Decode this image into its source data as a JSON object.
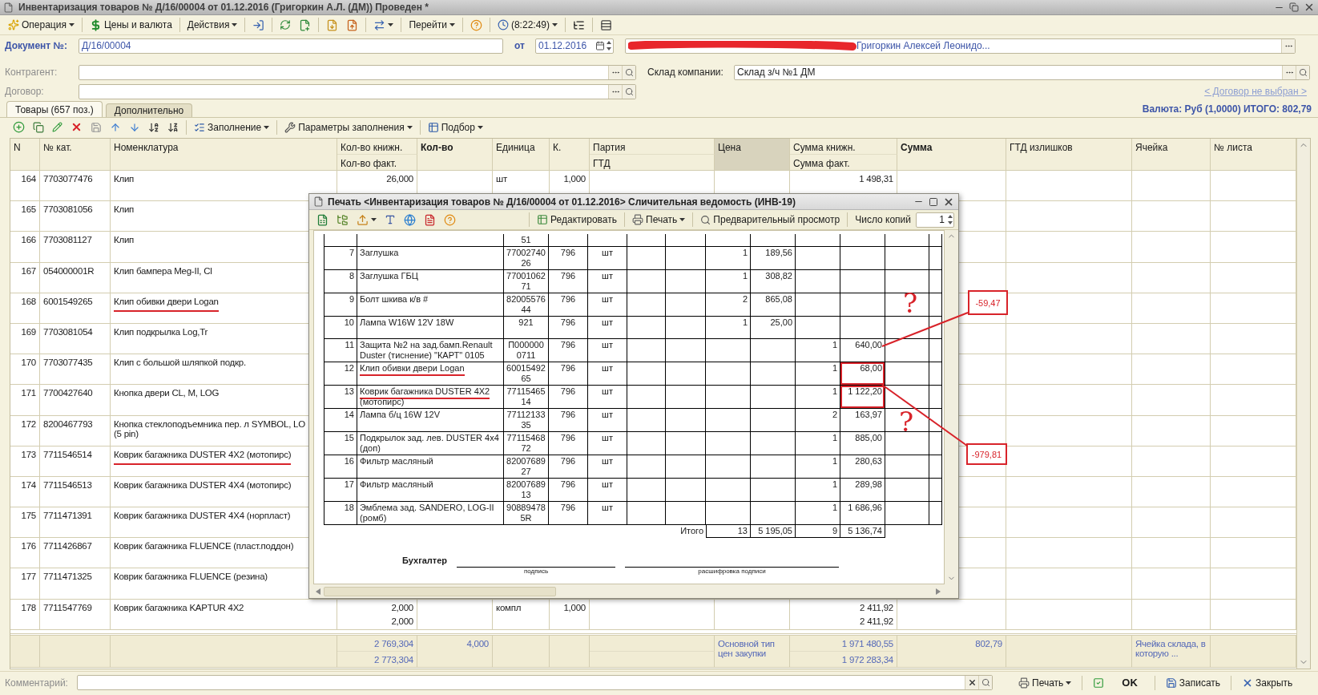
{
  "window": {
    "title": "Инвентаризация товаров № Д/16/00004 от 01.12.2016 (Григоркин А.Л. (ДМ)) Проведен *"
  },
  "toolbar": {
    "operation": "Операция",
    "prices": "Цены и валюта",
    "actions": "Действия",
    "goto": "Перейти",
    "time": "(8:22:49)"
  },
  "document": {
    "label": "Документ №:",
    "number": "Д/16/00004",
    "date_label": "от",
    "date": "01.12.2016",
    "responsible": "Григоркин Алексей Леонидо..."
  },
  "counterparty": {
    "label": "Контрагент:"
  },
  "contract": {
    "label": "Договор:",
    "link": "< Договор не выбран >"
  },
  "warehouse": {
    "label": "Склад компании:",
    "value": "Склад з/ч №1 ДМ"
  },
  "tabs": [
    {
      "label": "Товары (657 поз.)",
      "selected": true
    },
    {
      "label": "Дополнительно",
      "selected": false
    }
  ],
  "totals_line": "Валюта: Руб (1,0000) ИТОГО: 802,79",
  "table_toolbar": {
    "fill": "Заполнение",
    "fill_params": "Параметры заполнения",
    "pick": "Подбор"
  },
  "table": {
    "columns": [
      {
        "label": "N",
        "bold": false,
        "sorted": false
      },
      {
        "label": "№ кат.",
        "bold": false,
        "sorted": false
      },
      {
        "label": "Номенклатура",
        "bold": false,
        "sorted": false
      },
      {
        "label": "Кол-во книжн.",
        "sub": "Кол-во факт.",
        "bold": false,
        "sorted": false
      },
      {
        "label": "Кол-во",
        "bold": true,
        "sorted": false
      },
      {
        "label": "Единица",
        "bold": false,
        "sorted": false
      },
      {
        "label": "К.",
        "bold": false,
        "sorted": false
      },
      {
        "label": "Партия",
        "sub": "ГТД",
        "bold": false,
        "sorted": false
      },
      {
        "label": "Цена",
        "bold": false,
        "sorted": true
      },
      {
        "label": "Сумма книжн.",
        "sub": "Сумма факт.",
        "bold": false,
        "sorted": false
      },
      {
        "label": "Сумма",
        "bold": true,
        "sorted": false
      },
      {
        "label": "ГТД излишков",
        "bold": false,
        "sorted": false
      },
      {
        "label": "Ячейка",
        "bold": false,
        "sorted": false
      },
      {
        "label": "№ листа",
        "bold": false,
        "sorted": false
      }
    ],
    "rows": [
      {
        "n": "164",
        "cat": "7703077476",
        "name": "Клип",
        "qty_book": "26,000",
        "unit": "шт",
        "k": "1,000",
        "sum_book": "1 498,31",
        "underlined": false
      },
      {
        "n": "165",
        "cat": "7703081056",
        "name": "Клип",
        "underlined": false
      },
      {
        "n": "166",
        "cat": "7703081127",
        "name": "Клип",
        "underlined": false
      },
      {
        "n": "167",
        "cat": "054000001R",
        "name": "Клип бампера  Meg-II, Cl",
        "underlined": false
      },
      {
        "n": "168",
        "cat": "6001549265",
        "name": "Клип обивки двери Logan",
        "underlined": true
      },
      {
        "n": "169",
        "cat": "7703081054",
        "name": "Клип подкрылка Log,Tr",
        "underlined": false
      },
      {
        "n": "170",
        "cat": "7703077435",
        "name": "Клип с большой шляпкой подкр.",
        "underlined": false
      },
      {
        "n": "171",
        "cat": "7700427640",
        "name": "Кнопка двери CL, M, LOG",
        "underlined": false
      },
      {
        "n": "172",
        "cat": "8200467793",
        "name": "Кнопка стеклоподъемника пер. л SYMBOL,  LO\n(5 pin)",
        "underlined": false
      },
      {
        "n": "173",
        "cat": "7711546514",
        "name": "Коврик багажника DUSTER  4X2 (мотопирс)",
        "underlined": true
      },
      {
        "n": "174",
        "cat": "7711546513",
        "name": "Коврик багажника DUSTER  4X4 (мотопирс)",
        "underlined": false
      },
      {
        "n": "175",
        "cat": "7711471391",
        "name": "Коврик багажника DUSTER  4X4 (норпласт)",
        "underlined": false
      },
      {
        "n": "176",
        "cat": "7711426867",
        "name": "Коврик багажника FLUENCE (пласт.поддон)",
        "underlined": false
      },
      {
        "n": "177",
        "cat": "7711471325",
        "name": "Коврик багажника FLUENCE (резина)",
        "underlined": false
      },
      {
        "n": "178",
        "cat": "7711547769",
        "name": "Коврик багажника KAPTUR 4X2",
        "qty_book": "2,000",
        "qty_fact": "2,000",
        "unit": "компл",
        "k": "1,000",
        "sum_book": "2 411,92",
        "sum_fact": "2 411,92",
        "underlined": false
      }
    ],
    "footer": {
      "qty_book": "2 769,304",
      "qty_fact": "2 773,304",
      "qty": "4,000",
      "price": "Основной тип цен закупки",
      "sum_book": "1 971 480,55",
      "sum_fact": "1 972 283,34",
      "sum": "802,79",
      "cell": "Ячейка склада, в которую ..."
    }
  },
  "bottom_bar": {
    "comment_label": "Комментарий:",
    "print": "Печать",
    "ok": "OK",
    "save": "Записать",
    "close": "Закрыть"
  },
  "print_window": {
    "title": "Печать <Инвентаризация товаров № Д/16/00004 от 01.12.2016> Сличительная ведомость (ИНВ-19)",
    "edit": "Редактировать",
    "print": "Печать",
    "preview": "Предварительный просмотр",
    "copies_label": "Число копий",
    "copies": "1",
    "top_row_code": "51",
    "rows": [
      {
        "n": "7",
        "name": "Заглушка",
        "code": "7700274026",
        "okei": "796",
        "unit": "шт",
        "qty_book": "1",
        "sum_book": "189,56",
        "underlined": false,
        "boxed": false
      },
      {
        "n": "8",
        "name": "Заглушка ГБЦ",
        "code": "7700106271",
        "okei": "796",
        "unit": "шт",
        "qty_book": "1",
        "sum_book": "308,82",
        "underlined": false,
        "boxed": false
      },
      {
        "n": "9",
        "name": "Болт шкива к/в #",
        "code": "8200557644",
        "okei": "796",
        "unit": "шт",
        "qty_book": "2",
        "sum_book": "865,08",
        "underlined": false,
        "boxed": false
      },
      {
        "n": "10",
        "name": "Лампа W16W 12V 18W",
        "code": "921",
        "okei": "796",
        "unit": "шт",
        "qty_book": "1",
        "sum_book": "25,00",
        "underlined": false,
        "boxed": false
      },
      {
        "n": "11",
        "name": "Защита №2  на зад.бамп.Renault Duster (тиснение) \"КАРТ\" 0105",
        "code": "П0000000711",
        "okei": "796",
        "unit": "шт",
        "qty_fact": "1",
        "sum_fact": "640,00",
        "underlined": false,
        "boxed": false
      },
      {
        "n": "12",
        "name": "Клип обивки двери Logan",
        "code": "6001549265",
        "okei": "796",
        "unit": "шт",
        "qty_fact": "1",
        "sum_fact": "68,00",
        "underlined": true,
        "boxed": true
      },
      {
        "n": "13",
        "name": "Коврик багажника DUSTER  4X2 (мотопирс)",
        "code": "7711546514",
        "okei": "796",
        "unit": "шт",
        "qty_fact": "1",
        "sum_fact": "1 122,20",
        "underlined": true,
        "boxed": true
      },
      {
        "n": "14",
        "name": "Лампа б/ц 16W 12V",
        "code": "7711213335",
        "okei": "796",
        "unit": "шт",
        "qty_fact": "2",
        "sum_fact": "163,97",
        "underlined": false,
        "boxed": false
      },
      {
        "n": "15",
        "name": "Подкрылок зад. лев. DUSTER 4x4 (доп)",
        "code": "7711546872",
        "okei": "796",
        "unit": "шт",
        "qty_fact": "1",
        "sum_fact": "885,00",
        "underlined": false,
        "boxed": false
      },
      {
        "n": "16",
        "name": "Фильтр масляный",
        "code": "8200768927",
        "okei": "796",
        "unit": "шт",
        "qty_fact": "1",
        "sum_fact": "280,63",
        "underlined": false,
        "boxed": false
      },
      {
        "n": "17",
        "name": "Фильтр масляный",
        "code": "8200768913",
        "okei": "796",
        "unit": "шт",
        "qty_fact": "1",
        "sum_fact": "289,98",
        "underlined": false,
        "boxed": false
      },
      {
        "n": "18",
        "name": "Эмблема зад. SANDERO, LOG-II (ромб)",
        "code": "908894785R",
        "okei": "796",
        "unit": "шт",
        "qty_fact": "1",
        "sum_fact": "1 686,96",
        "underlined": false,
        "boxed": false
      }
    ],
    "totals": {
      "label": "Итого",
      "qty_book": "13",
      "sum_book": "5 195,05",
      "qty_fact": "9",
      "sum_fact": "5 136,74"
    },
    "signature": {
      "role": "Бухгалтер",
      "caption_sign": "подпись",
      "caption_name": "расшифровка подписи"
    }
  },
  "annotations": [
    {
      "kind": "question",
      "text": "?"
    },
    {
      "kind": "callout",
      "text": "-59,47"
    },
    {
      "kind": "question",
      "text": "?"
    },
    {
      "kind": "callout",
      "text": "-979,81"
    }
  ]
}
